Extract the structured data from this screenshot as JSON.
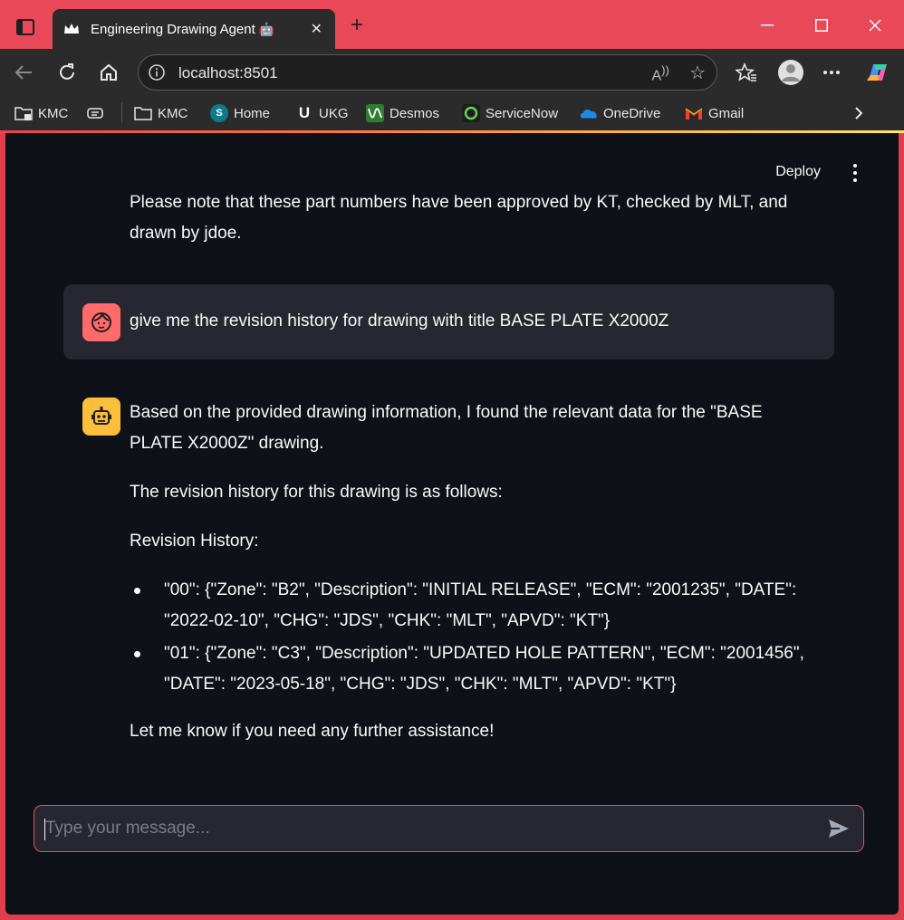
{
  "browser": {
    "tab_title": "Engineering Drawing Agent",
    "tab_emoji": "🤖",
    "url": "localhost:8501"
  },
  "bookmarks": [
    {
      "label": "KMC",
      "icon": "folder-icon"
    },
    {
      "label": "KMC",
      "icon": "folder-icon"
    },
    {
      "label": "Home",
      "icon": "sharepoint-icon"
    },
    {
      "label": "UKG",
      "icon": "ukg-icon"
    },
    {
      "label": "Desmos",
      "icon": "desmos-icon"
    },
    {
      "label": "ServiceNow",
      "icon": "servicenow-icon"
    },
    {
      "label": "OneDrive",
      "icon": "onedrive-icon"
    },
    {
      "label": "Gmail",
      "icon": "gmail-icon"
    }
  ],
  "app": {
    "deploy_label": "Deploy",
    "previous_message_cut": "Please note that these part numbers have been approved by KT, checked by MLT, and drawn by jdoe.",
    "user_message": "give me the revision history for drawing with title BASE PLATE X2000Z",
    "assistant": {
      "intro": "Based on the provided drawing information, I found the relevant data for the \"BASE PLATE X2000Z\" drawing.",
      "line2": "The revision history for this drawing is as follows:",
      "heading": "Revision History:",
      "revisions": [
        "\"00\": {\"Zone\": \"B2\", \"Description\": \"INITIAL RELEASE\", \"ECM\": \"2001235\", \"DATE\": \"2022-02-10\", \"CHG\": \"JDS\", \"CHK\": \"MLT\", \"APVD\": \"KT\"}",
        "\"01\": {\"Zone\": \"C3\", \"Description\": \"UPDATED HOLE PATTERN\", \"ECM\": \"2001456\", \"DATE\": \"2023-05-18\", \"CHG\": \"JDS\", \"CHK\": \"MLT\", \"APVD\": \"KT\"}"
      ],
      "closing": "Let me know if you need any further assistance!"
    },
    "input_placeholder": "Type your message..."
  },
  "colors": {
    "titlebar": "#e84858",
    "app_bg": "#0e1117",
    "user_avatar": "#ff6b6b",
    "bot_avatar": "#fbbf3c",
    "input_border": "#e0505b"
  }
}
